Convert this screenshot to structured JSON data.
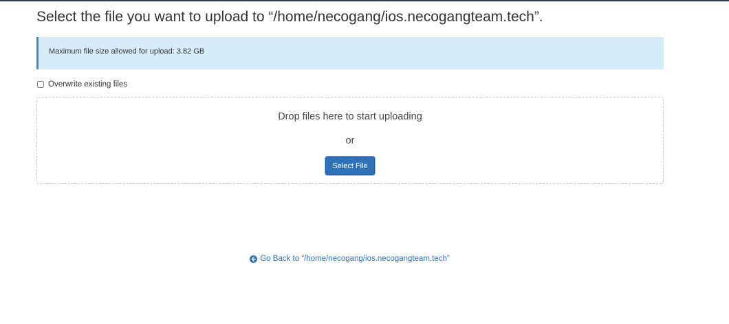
{
  "page": {
    "title": "Select the file you want to upload to “/home/necogang/ios.necogangteam.tech”."
  },
  "alert": {
    "text": "Maximum file size allowed for upload: 3.82 GB"
  },
  "overwrite": {
    "label": "Overwrite existing files",
    "checked": false
  },
  "dropzone": {
    "message": "Drop files here to start uploading",
    "or_text": "or",
    "select_button": "Select File"
  },
  "footer": {
    "go_back_label": "Go Back to “/home/necogang/ios.necogangteam.tech”",
    "go_back_icon": "arrow-circle-left-icon"
  },
  "colors": {
    "accent": "#2f72b8",
    "alert_bg": "#d7ecf9",
    "alert_border": "#3a8fc9"
  }
}
